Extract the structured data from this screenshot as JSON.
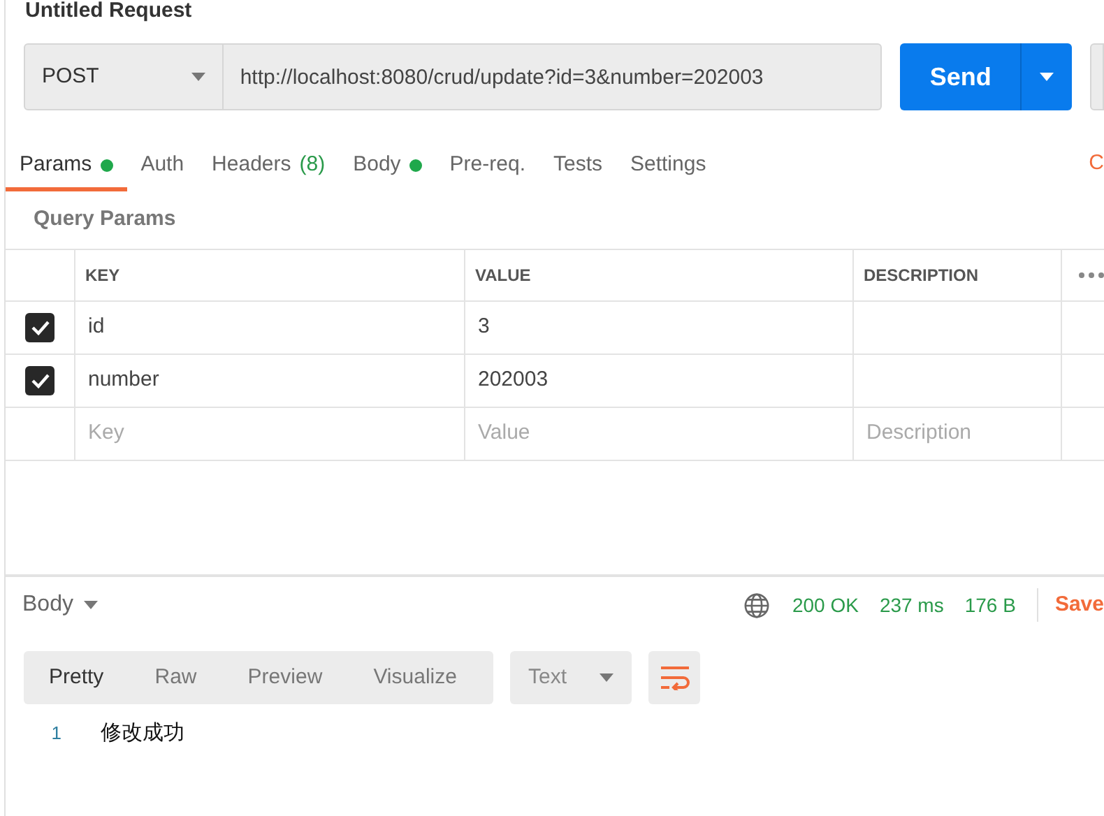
{
  "request_title": "Untitled Request",
  "request": {
    "method": "POST",
    "url": "http://localhost:8080/crud/update?id=3&number=202003",
    "send": "Send"
  },
  "tabs": [
    {
      "label": "Params",
      "dot": true,
      "selected": true
    },
    {
      "label": "Auth",
      "dot": false,
      "selected": false
    },
    {
      "label": "Headers",
      "count": "(8)",
      "dot": false,
      "selected": false
    },
    {
      "label": "Body",
      "dot": true,
      "selected": false
    },
    {
      "label": "Pre-req.",
      "dot": false,
      "selected": false
    },
    {
      "label": "Tests",
      "dot": false,
      "selected": false
    },
    {
      "label": "Settings",
      "dot": false,
      "selected": false
    }
  ],
  "cookies_link": "C",
  "params": {
    "title": "Query Params",
    "columns": [
      "KEY",
      "VALUE",
      "DESCRIPTION"
    ],
    "rows": [
      {
        "checked": true,
        "key": "id",
        "value": "3"
      },
      {
        "checked": true,
        "key": "number",
        "value": "202003"
      }
    ],
    "placeholders": {
      "key": "Key",
      "value": "Value",
      "description": "Description"
    }
  },
  "response": {
    "section": "Body",
    "status": "200 OK",
    "time": "237 ms",
    "size": "176 B",
    "save": "Save",
    "views": [
      {
        "label": "Pretty",
        "selected": true
      },
      {
        "label": "Raw",
        "selected": false
      },
      {
        "label": "Preview",
        "selected": false
      },
      {
        "label": "Visualize",
        "selected": false
      }
    ],
    "format": "Text",
    "lines": [
      {
        "number": "1",
        "text": "修改成功"
      }
    ]
  }
}
